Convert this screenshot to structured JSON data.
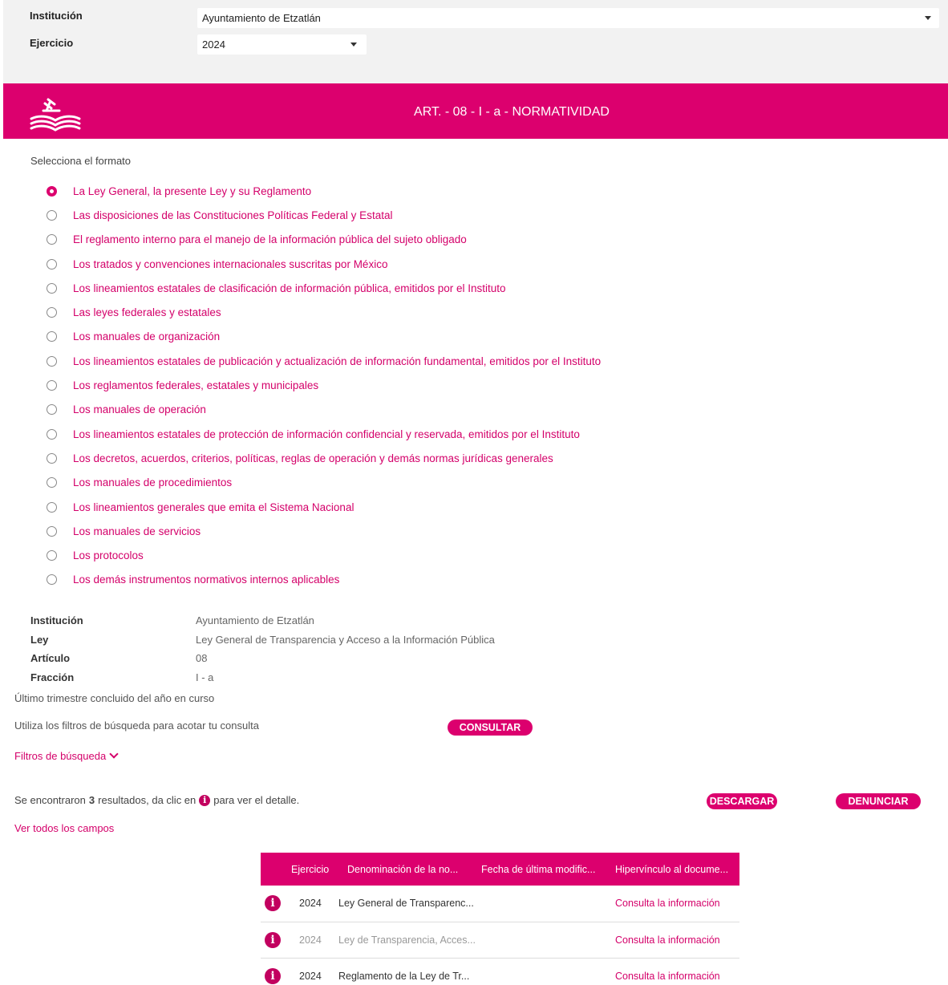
{
  "filters": {
    "institution_label": "Institución",
    "institution_value": "Ayuntamiento de Etzatlán",
    "year_label": "Ejercicio",
    "year_value": "2024"
  },
  "banner": {
    "title": "ART. - 08 - I - a - NORMATIVIDAD",
    "icon": "gavel-book-icon"
  },
  "format": {
    "prompt": "Selecciona el formato",
    "selected_index": 0,
    "options": [
      "La Ley General, la presente Ley y su Reglamento",
      "Las disposiciones de las Constituciones Políticas Federal y Estatal",
      "El reglamento interno para el manejo de la información pública del sujeto obligado",
      "Los tratados y convenciones internacionales suscritas por México",
      "Los lineamientos estatales de clasificación de información pública, emitidos por el Instituto",
      "Las leyes federales y estatales",
      "Los manuales de organización",
      "Los lineamientos estatales de publicación y actualización de información fundamental, emitidos por el Instituto",
      "Los reglamentos federales, estatales y municipales",
      "Los manuales de operación",
      "Los lineamientos estatales de protección de información confidencial y reservada, emitidos por el Instituto",
      "Los decretos, acuerdos, criterios, políticas, reglas de operación y demás normas jurídicas generales",
      "Los manuales de procedimientos",
      "Los lineamientos generales que emita el Sistema Nacional",
      "Los manuales de servicios",
      "Los protocolos",
      "Los demás instrumentos normativos internos aplicables"
    ]
  },
  "info": [
    {
      "key": "Institución",
      "value": "Ayuntamiento de Etzatlán"
    },
    {
      "key": "Ley",
      "value": "Ley General de Transparencia y Acceso a la Información Pública"
    },
    {
      "key": "Artículo",
      "value": "08"
    },
    {
      "key": "Fracción",
      "value": "I - a"
    }
  ],
  "notes": {
    "trimester": "Último trimestre concluido del año en curso",
    "filters_hint": "Utiliza los filtros de búsqueda para acotar tu consulta",
    "consult_button": "CONSULTAR",
    "filters_link": "Filtros de búsqueda",
    "results_prefix": "Se encontraron",
    "results_count": "3",
    "results_mid": "resultados, da clic en",
    "results_suffix": "para ver el detalle.",
    "download_button": "DESCARGAR",
    "report_button": "DENUNCIAR",
    "all_fields_link": "Ver todos los campos"
  },
  "table": {
    "headers": [
      "Ejercicio",
      "Denominación de la no...",
      "Fecha de última modific...",
      "Hipervínculo al docume..."
    ],
    "rows": [
      {
        "year": "2024",
        "name": "Ley General de Transparenc...",
        "date": "",
        "link": "Consulta la información",
        "muted": false
      },
      {
        "year": "2024",
        "name": "Ley de Transparencia, Acces...",
        "date": "",
        "link": "Consulta la información",
        "muted": true
      },
      {
        "year": "2024",
        "name": "Reglamento de la Ley de Tr...",
        "date": "",
        "link": "Consulta la información",
        "muted": false
      }
    ]
  },
  "colors": {
    "brand": "#dc006e",
    "panel": "#f2f2f2"
  }
}
